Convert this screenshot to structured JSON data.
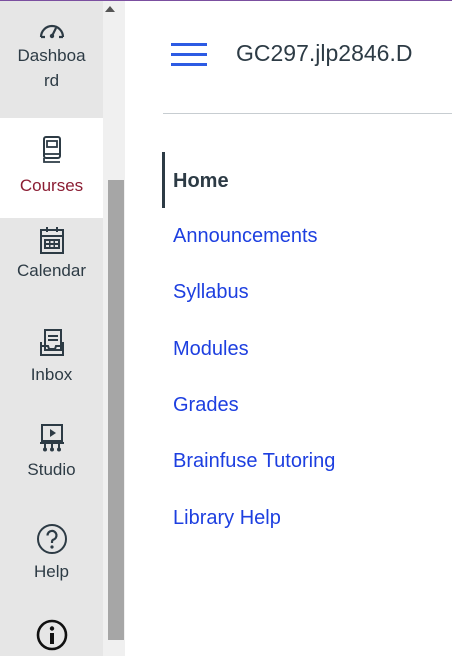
{
  "global_nav": {
    "items": [
      {
        "label": "Dashboard",
        "line1": "Dashboa",
        "line2": "rd",
        "icon": "dashboard-icon"
      },
      {
        "label": "Courses",
        "icon": "courses-icon",
        "active": true
      },
      {
        "label": "Calendar",
        "icon": "calendar-icon"
      },
      {
        "label": "Inbox",
        "icon": "inbox-icon"
      },
      {
        "label": "Studio",
        "icon": "studio-icon"
      },
      {
        "label": "Help",
        "icon": "help-icon"
      },
      {
        "label": "",
        "icon": "info-icon"
      }
    ],
    "active_color": "#8b1d33"
  },
  "header": {
    "course_title": "GC297.jlp2846.D"
  },
  "course_nav": {
    "items": [
      {
        "label": "Home",
        "active": true
      },
      {
        "label": "Announcements"
      },
      {
        "label": "Syllabus"
      },
      {
        "label": "Modules"
      },
      {
        "label": "Grades"
      },
      {
        "label": "Brainfuse Tutoring"
      },
      {
        "label": "Library Help"
      }
    ],
    "link_color": "#1d3fe0"
  }
}
